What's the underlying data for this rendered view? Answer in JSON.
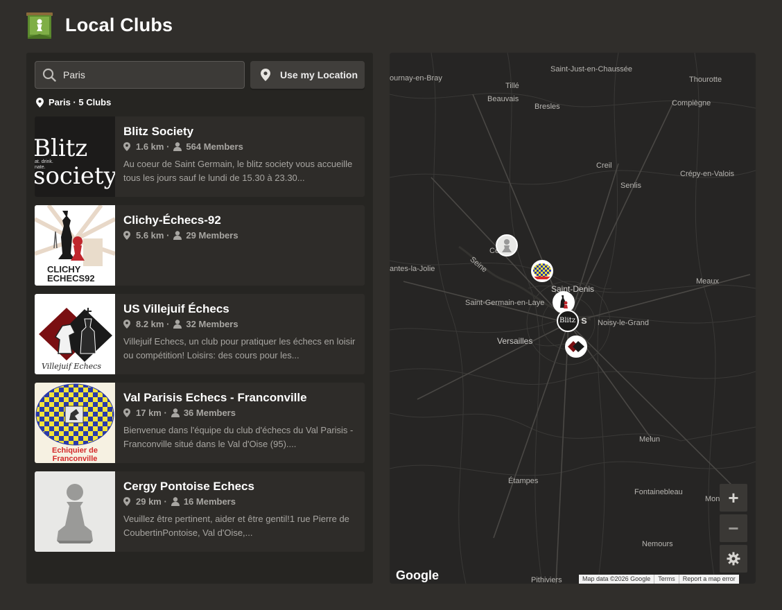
{
  "page": {
    "title": "Local Clubs"
  },
  "search": {
    "value": "Paris",
    "button_label": "Use my Location"
  },
  "results": {
    "summary": "Paris · 5 Clubs"
  },
  "clubs": [
    {
      "name": "Blitz Society",
      "distance": "1.6 km ·",
      "members": "564 Members",
      "description": "Au coeur de Saint Germain, le blitz society vous accueille tous les jours sauf le lundi de 15.30 à 23.30...",
      "logo_text": "Blitz society",
      "logo_side_text": "at. drink. nate."
    },
    {
      "name": "Clichy-Échecs-92",
      "distance": "5.6 km ·",
      "members": "29 Members",
      "description": "",
      "logo_text": "CLICHY ECHECS92"
    },
    {
      "name": "US Villejuif Échecs",
      "distance": "8.2 km ·",
      "members": "32 Members",
      "description": "Villejuif Echecs, un club pour pratiquer les échecs en loisir ou compétition! Loisirs: des cours pour les...",
      "logo_text": "Villejuif Echecs"
    },
    {
      "name": "Val Parisis Echecs - Franconville",
      "distance": "17 km ·",
      "members": "36 Members",
      "description": "Bienvenue dans l'équipe du club d'échecs du Val Parisis - Franconville situé dans le Val d'Oise (95)....",
      "logo_text_1": "Echiquier de",
      "logo_text_2": "Franconville"
    },
    {
      "name": "Cergy Pontoise Echecs",
      "distance": "29 km ·",
      "members": "16 Members",
      "description": "Veuillez être pertinent, aider et être gentil!1 rue Pierre de CoubertinPontoise, Val d'Oise,..."
    }
  ],
  "map": {
    "towns": [
      "Saint-Just-en-Chaussée",
      "ournay-en-Bray",
      "Thourotte",
      "Tillé",
      "Beauvais",
      "Bresles",
      "Compiègne",
      "Creil",
      "Crépy-en-Valois",
      "Senlis",
      "Ce",
      "Seine",
      "antes-la-Jolie",
      "Saint-Denis",
      "Meaux",
      "Saint-Germain-en-Laye",
      "s",
      "Noisy-le-Grand",
      "Versailles",
      "Melun",
      "Étampes",
      "Fontainebleau",
      "Monteau",
      "Nemours",
      "Pithiviers"
    ],
    "zoom_in": "+",
    "zoom_out": "−",
    "google_logo": "Google",
    "attribution": {
      "data": "Map data ©2026 Google",
      "terms": "Terms",
      "report": "Report a map error"
    }
  },
  "icons": {
    "logo": "pawn-flag-icon",
    "search": "search-icon",
    "location": "pin-icon",
    "members": "user-icon",
    "settings": "gear-icon"
  },
  "colors": {
    "background": "#302e2b",
    "panel": "#262522",
    "card": "#2e2c29",
    "accent_green": "#81b64c",
    "muted_text": "#a8a6a2"
  }
}
